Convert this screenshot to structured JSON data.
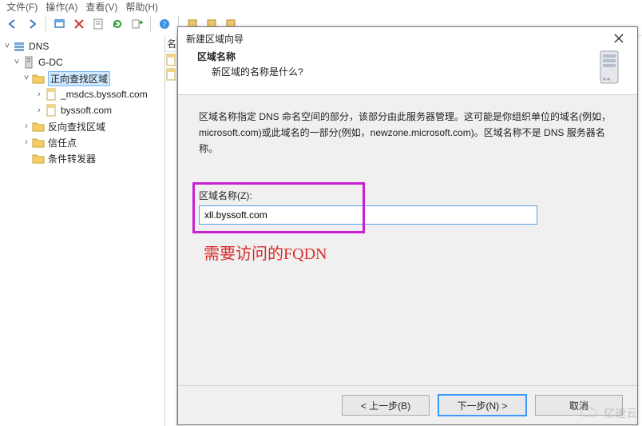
{
  "menubar": {
    "items": [
      "文件(F)",
      "操作(A)",
      "查看(V)",
      "帮助(H)"
    ]
  },
  "tree": {
    "root": "DNS",
    "server": "G-DC",
    "fwd_zone": "正向查找区域",
    "zones": [
      "_msdcs.byssoft.com",
      "byssoft.com"
    ],
    "rev_zone": "反向查找区域",
    "trust_points": "信任点",
    "forwarders": "条件转发器"
  },
  "list_header": "名",
  "wizard": {
    "title": "新建区域向导",
    "heading": "区域名称",
    "subheading": "新区域的名称是什么?",
    "description": "区域名称指定 DNS 命名空间的部分，该部分由此服务器管理。这可能是你组织单位的域名(例如，microsoft.com)或此域名的一部分(例如，newzone.microsoft.com)。区域名称不是 DNS 服务器名称。",
    "field_label": "区域名称(Z):",
    "field_value": "xll.byssoft.com",
    "annotation": "需要访问的FQDN",
    "back_label": "< 上一步(B)",
    "next_label": "下一步(N) >",
    "cancel_label": "取消"
  },
  "watermark": "亿速云"
}
